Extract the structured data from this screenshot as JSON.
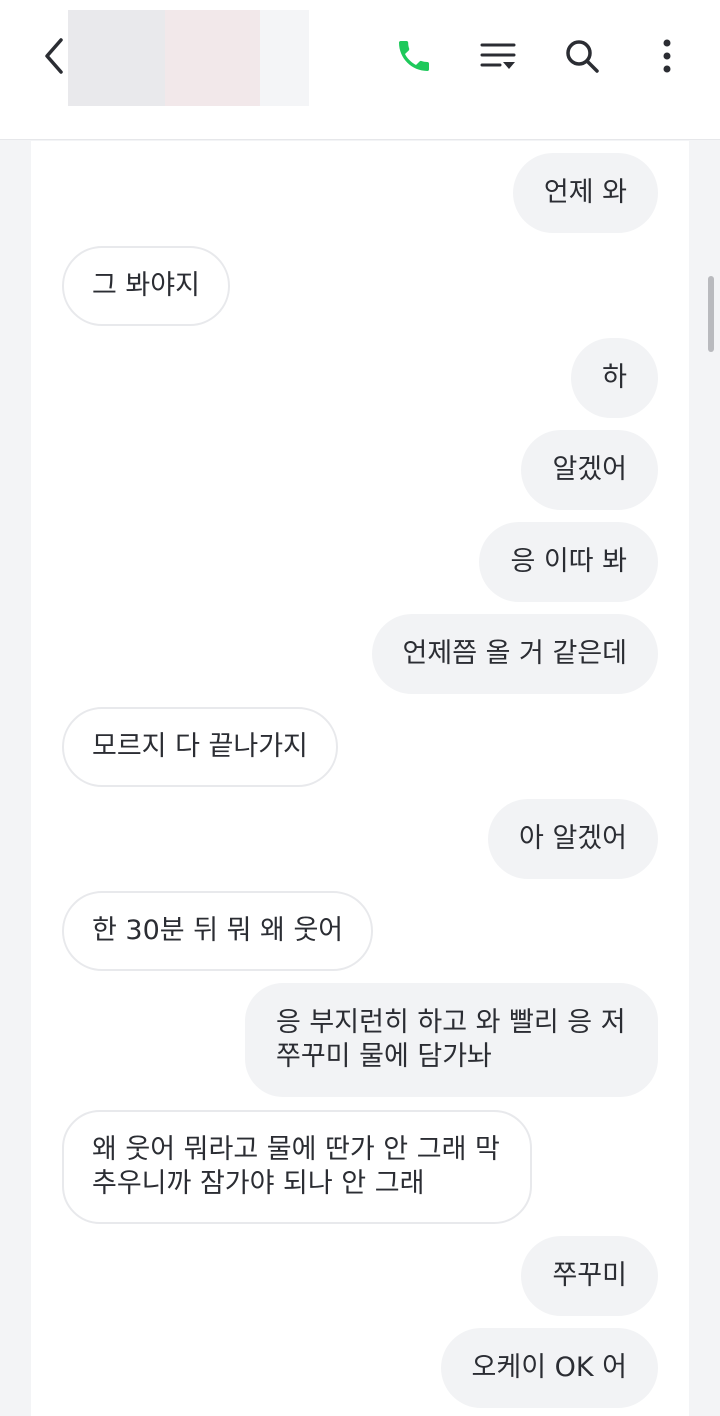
{
  "header": {
    "back_icon": "chevron-left-icon",
    "call_icon": "phone-icon",
    "menu_icon": "filter-menu-icon",
    "search_icon": "search-icon",
    "more_icon": "more-vertical-icon",
    "accent_color": "#1ec95b"
  },
  "messages": [
    {
      "sender": "me",
      "text": "언제 와"
    },
    {
      "sender": "them",
      "text": "그 봐야지"
    },
    {
      "sender": "me",
      "text": "하"
    },
    {
      "sender": "me",
      "text": "알겠어"
    },
    {
      "sender": "me",
      "text": "응 이따 봐"
    },
    {
      "sender": "me",
      "text": "언제쯤 올 거 같은데"
    },
    {
      "sender": "them",
      "text": "모르지 다 끝나가지"
    },
    {
      "sender": "me",
      "text": "아 알겠어"
    },
    {
      "sender": "them",
      "text": "한 30분 뒤 뭐 왜 웃어"
    },
    {
      "sender": "me",
      "text": "응 부지런히 하고 와 빨리 응 저\n쭈꾸미 물에 담가놔"
    },
    {
      "sender": "them",
      "text": "왜 웃어 뭐라고 물에 딴가 안 그래 막\n추우니까 잠가야 되나 안 그래"
    },
    {
      "sender": "me",
      "text": "쭈꾸미"
    },
    {
      "sender": "me",
      "text": "오케이 OK 어"
    }
  ]
}
